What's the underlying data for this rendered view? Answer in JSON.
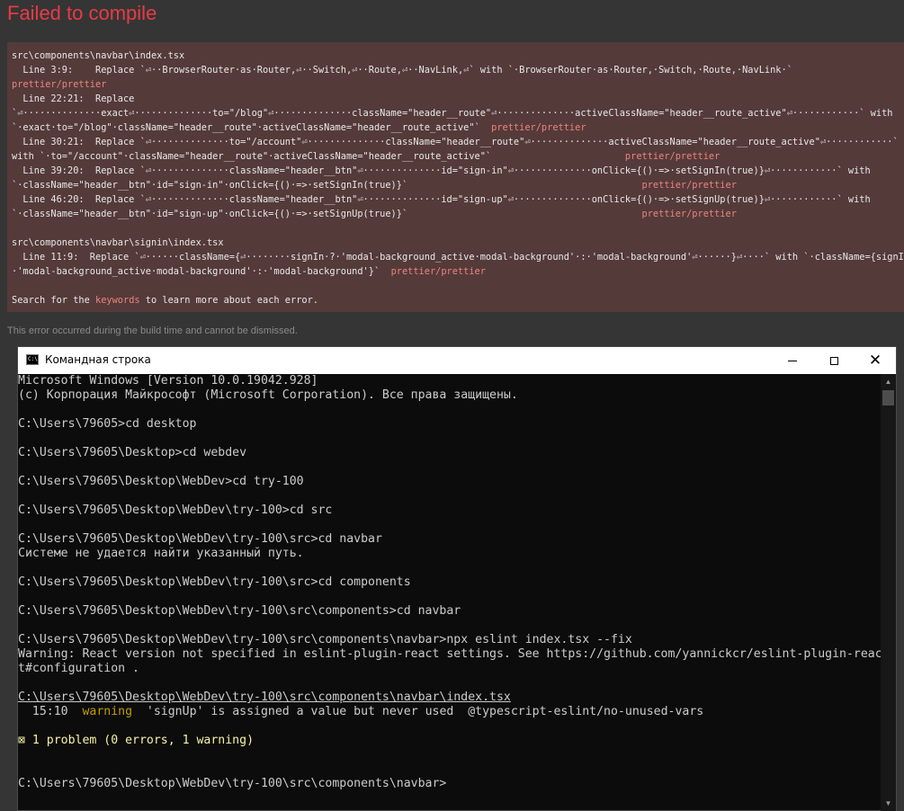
{
  "overlay": {
    "title": "Failed to compile",
    "footnote": "This error occurred during the build time and cannot be dismissed.",
    "search_prefix": "Search for the ",
    "search_keyword": "keywords",
    "search_suffix": " to learn more about each error."
  },
  "errors": [
    {
      "text": "src\\components\\navbar\\index.tsx",
      "tail": ""
    },
    {
      "text": "  Line 3:9:    Replace `⏎··BrowserRouter·as·Router,⏎··Switch,⏎··Route,⏎··NavLink,⏎` with `·BrowserRouter·as·Router,·Switch,·Route,·NavLink·`",
      "tail": ""
    },
    {
      "text": "",
      "tail": "prettier/prettier"
    },
    {
      "text": "  Line 22:21:  Replace",
      "tail": ""
    },
    {
      "text": "`⏎··············exact⏎··············to=\"/blog\"⏎··············className=\"header__route\"⏎··············activeClassName=\"header__route_active\"⏎············` with",
      "tail": ""
    },
    {
      "text": "`·exact·to=\"/blog\"·className=\"header__route\"·activeClassName=\"header__route_active\"`  ",
      "tail": "prettier/prettier"
    },
    {
      "text": "  Line 30:21:  Replace `⏎··············to=\"/account\"⏎··············className=\"header__route\"⏎··············activeClassName=\"header__route_active\"⏎············`",
      "tail": ""
    },
    {
      "text": "with `·to=\"/account\"·className=\"header__route\"·activeClassName=\"header__route_active\"`                        ",
      "tail": "prettier/prettier"
    },
    {
      "text": "  Line 39:20:  Replace `⏎··············className=\"header__btn\"⏎··············id=\"sign-in\"⏎··············onClick={()·=>·setSignIn(true)}⏎············` with",
      "tail": ""
    },
    {
      "text": "`·className=\"header__btn\"·id=\"sign-in\"·onClick={()·=>·setSignIn(true)}`                                          ",
      "tail": "prettier/prettier"
    },
    {
      "text": "  Line 46:20:  Replace `⏎··············className=\"header__btn\"⏎··············id=\"sign-up\"⏎··············onClick={()·=>·setSignUp(true)}⏎············` with",
      "tail": ""
    },
    {
      "text": "`·className=\"header__btn\"·id=\"sign-up\"·onClick={()·=>·setSignUp(true)}`                                          ",
      "tail": "prettier/prettier"
    },
    {
      "text": "",
      "tail": ""
    },
    {
      "text": "src\\components\\navbar\\signin\\index.tsx",
      "tail": ""
    },
    {
      "text": "  Line 11:9:  Replace `⏎······className={⏎········signIn·?·'modal-background_active·modal-background'·:·'modal-background'⏎······}⏎····` with `·className={signIn·?",
      "tail": ""
    },
    {
      "text": "·'modal-background_active·modal-background'·:·'modal-background'}`  ",
      "tail": "prettier/prettier"
    },
    {
      "text": "",
      "tail": ""
    }
  ],
  "cmd": {
    "title": "Командная строка",
    "icon_text": "C:\\",
    "lines": [
      {
        "text": "Microsoft Windows [Version 10.0.19042.928]"
      },
      {
        "text": "(c) Корпорация Майкрософт (Microsoft Corporation). Все права защищены."
      },
      {
        "text": ""
      },
      {
        "text": "C:\\Users\\79605>cd desktop"
      },
      {
        "text": ""
      },
      {
        "text": "C:\\Users\\79605\\Desktop>cd webdev"
      },
      {
        "text": ""
      },
      {
        "text": "C:\\Users\\79605\\Desktop\\WebDev>cd try-100"
      },
      {
        "text": ""
      },
      {
        "text": "C:\\Users\\79605\\Desktop\\WebDev\\try-100>cd src"
      },
      {
        "text": ""
      },
      {
        "text": "C:\\Users\\79605\\Desktop\\WebDev\\try-100\\src>cd navbar"
      },
      {
        "text": "Системе не удается найти указанный путь."
      },
      {
        "text": ""
      },
      {
        "text": "C:\\Users\\79605\\Desktop\\WebDev\\try-100\\src>cd components"
      },
      {
        "text": ""
      },
      {
        "text": "C:\\Users\\79605\\Desktop\\WebDev\\try-100\\src\\components>cd navbar"
      },
      {
        "text": ""
      },
      {
        "text": "C:\\Users\\79605\\Desktop\\WebDev\\try-100\\src\\components\\navbar>npx eslint index.tsx --fix"
      },
      {
        "text": "Warning: React version not specified in eslint-plugin-react settings. See https://github.com/yannickcr/eslint-plugin-reac"
      },
      {
        "text": "t#configuration ."
      },
      {
        "text": ""
      },
      {
        "text": "C:\\Users\\79605\\Desktop\\WebDev\\try-100\\src\\components\\navbar\\index.tsx"
      }
    ],
    "warning": {
      "location": "  15:10  ",
      "level": "warning",
      "message": "  'signUp' is assigned a value but never used  @typescript-eslint/no-unused-vars"
    },
    "summary": "⊠ 1 problem (0 errors, 1 warning)",
    "prompt": "C:\\Users\\79605\\Desktop\\WebDev\\try-100\\src\\components\\navbar>"
  }
}
